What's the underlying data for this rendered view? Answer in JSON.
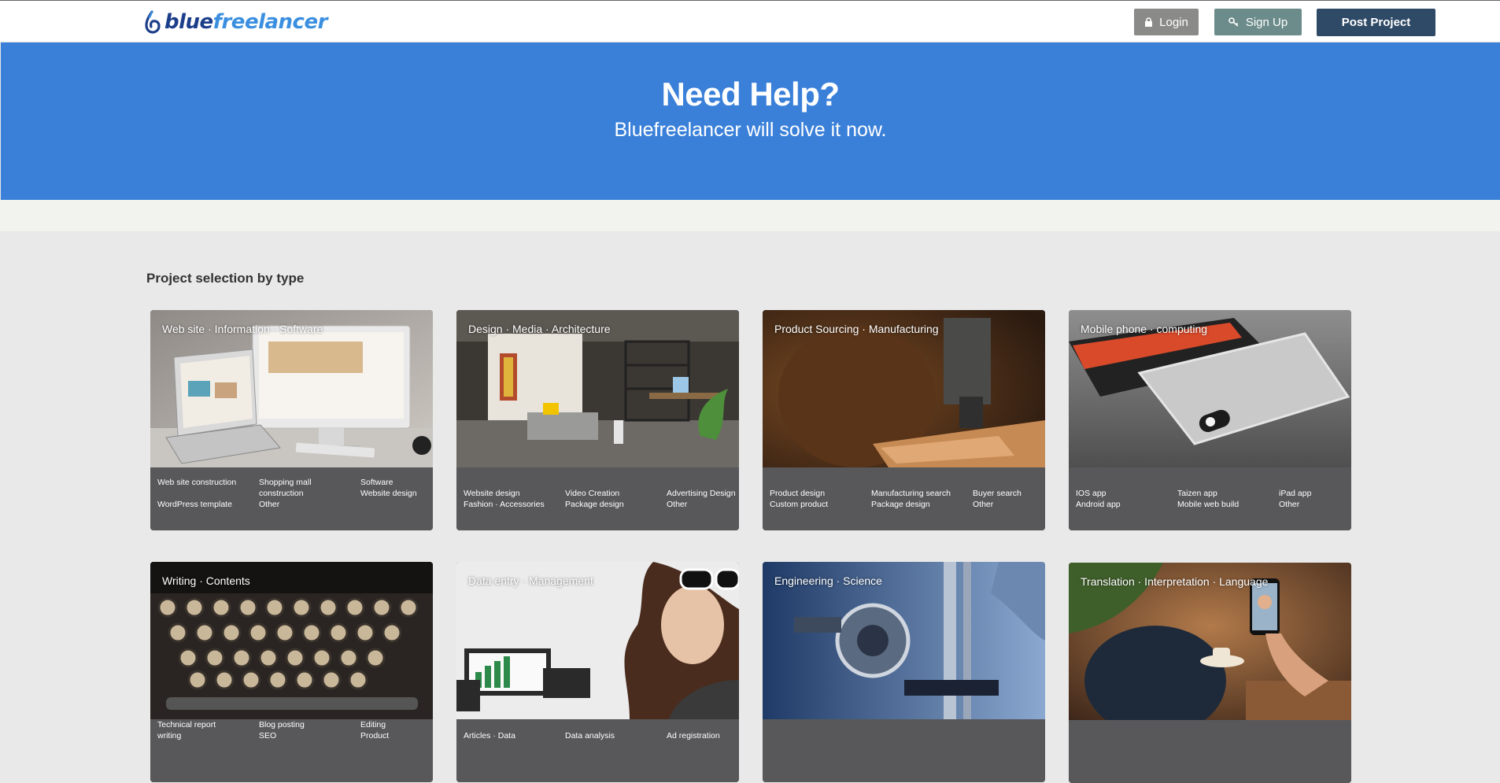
{
  "header": {
    "logo_blue_part": "blue",
    "logo_rest_part": "freelancer",
    "login_label": "Login",
    "signup_label": "Sign Up",
    "post_label": "Post Project"
  },
  "hero": {
    "title": "Need Help?",
    "subtitle": "Bluefreelancer will solve it now."
  },
  "section": {
    "title": "Project selection by type"
  },
  "cards": [
    {
      "title": "Web site · Information · Software",
      "items": [
        "Web site construction",
        "Shopping mall construction",
        "Software",
        "Website design",
        "WordPress template",
        "Other"
      ]
    },
    {
      "title": "Design · Media · Architecture",
      "items": [
        "Website design",
        "Video Creation",
        "Advertising Design",
        "Fashion · Accessories",
        "Package design",
        "Other"
      ]
    },
    {
      "title": "Product Sourcing · Manufacturing",
      "items": [
        "Product design",
        "Manufacturing search",
        "Buyer search",
        "Custom product",
        "Package design",
        "Other"
      ]
    },
    {
      "title": "Mobile phone · computing",
      "items": [
        "IOS app",
        "Taizen app",
        "iPad app",
        "Android app",
        "Mobile web build",
        "Other"
      ]
    },
    {
      "title": "Writing · Contents",
      "items": [
        "Technical report writing",
        "Blog posting",
        "Editing",
        "SEO",
        "Product"
      ]
    },
    {
      "title": "Data entry · Management",
      "items": [
        "Articles · Data",
        "Data analysis",
        "Ad registration"
      ]
    },
    {
      "title": "Engineering · Science",
      "items": []
    },
    {
      "title": "Translation · Interpretation · Language",
      "items": []
    }
  ],
  "colors": {
    "brand_dark": "#1c3e8a",
    "brand_light": "#3a8fe0",
    "hero_bg": "#3a80d9",
    "card_footer": "#58585a",
    "login_btn": "#8a8a88",
    "signup_btn": "#6b8c8a",
    "post_btn": "#2f4a66"
  }
}
